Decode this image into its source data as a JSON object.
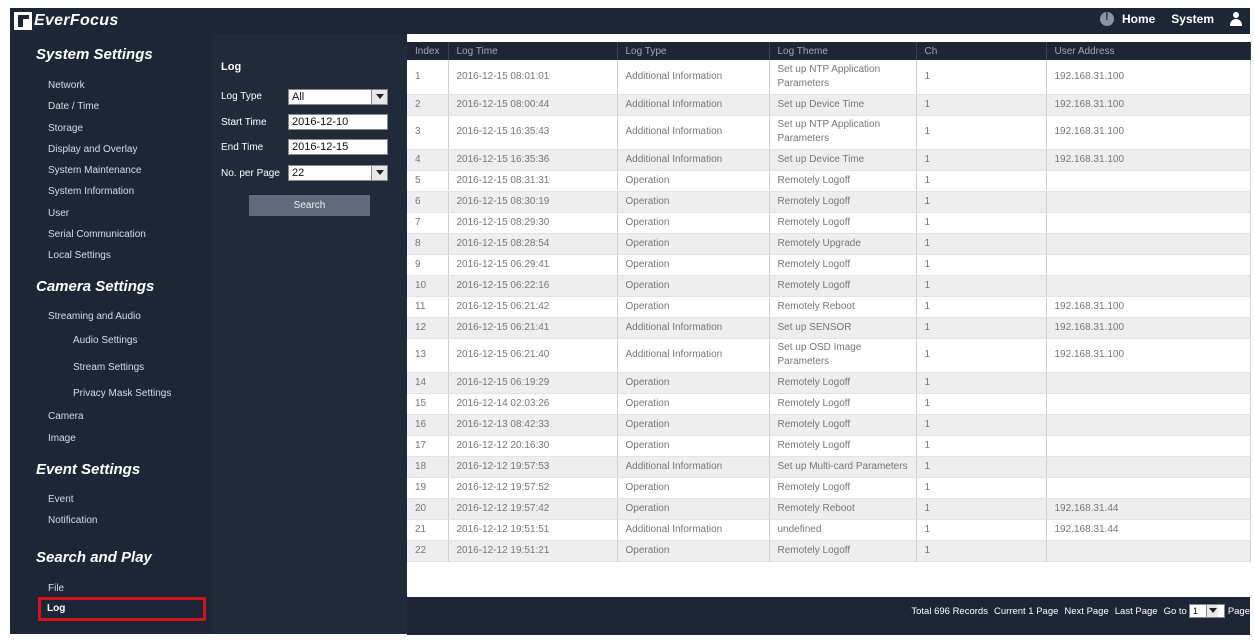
{
  "header": {
    "brand": "EverFocus",
    "home": "Home",
    "system": "System"
  },
  "sidebar": {
    "system_settings": "System Settings",
    "system_items": [
      "Network",
      "Date / Time",
      "Storage",
      "Display and Overlay",
      "System Maintenance",
      "System Information",
      "User",
      "Serial Communication",
      "Local Settings"
    ],
    "camera_settings": "Camera Settings",
    "streaming": "Streaming and Audio",
    "audio": "Audio Settings",
    "stream": "Stream Settings",
    "privacy": "Privacy Mask Settings",
    "camera": "Camera",
    "image": "Image",
    "event_settings": "Event Settings",
    "event": "Event",
    "notification": "Notification",
    "search_play": "Search and Play",
    "file": "File",
    "log": "Log"
  },
  "filter": {
    "title": "Log",
    "log_type_label": "Log Type",
    "log_type_value": "All",
    "start_label": "Start Time",
    "start_value": "2016-12-10",
    "end_label": "End Time",
    "end_value": "2016-12-15",
    "per_page_label": "No. per Page",
    "per_page_value": "22",
    "search_label": "Search"
  },
  "table": {
    "headers": [
      "Index",
      "Log Time",
      "Log Type",
      "Log Theme",
      "Ch",
      "User Address"
    ],
    "rows": [
      [
        "1",
        "2016-12-15 08:01:01",
        "Additional Information",
        "Set up NTP Application Parameters",
        "1",
        "192.168.31.100"
      ],
      [
        "2",
        "2016-12-15 08:00:44",
        "Additional Information",
        "Set up Device Time",
        "1",
        "192.168.31.100"
      ],
      [
        "3",
        "2016-12-15 16:35:43",
        "Additional Information",
        "Set up NTP Application Parameters",
        "1",
        "192.168.31.100"
      ],
      [
        "4",
        "2016-12-15 16:35:36",
        "Additional Information",
        "Set up Device Time",
        "1",
        "192.168.31.100"
      ],
      [
        "5",
        "2016-12-15 08:31:31",
        "Operation",
        "Remotely Logoff",
        "1",
        ""
      ],
      [
        "6",
        "2016-12-15 08:30:19",
        "Operation",
        "Remotely Logoff",
        "1",
        ""
      ],
      [
        "7",
        "2016-12-15 08:29:30",
        "Operation",
        "Remotely Logoff",
        "1",
        ""
      ],
      [
        "8",
        "2016-12-15 08:28:54",
        "Operation",
        "Remotely Upgrade",
        "1",
        ""
      ],
      [
        "9",
        "2016-12-15 06:29:41",
        "Operation",
        "Remotely Logoff",
        "1",
        ""
      ],
      [
        "10",
        "2016-12-15 06:22:16",
        "Operation",
        "Remotely Logoff",
        "1",
        ""
      ],
      [
        "11",
        "2016-12-15 06:21:42",
        "Operation",
        "Remotely Reboot",
        "1",
        "192.168.31.100"
      ],
      [
        "12",
        "2016-12-15 06:21:41",
        "Additional Information",
        "Set up SENSOR",
        "1",
        "192.168.31.100"
      ],
      [
        "13",
        "2016-12-15 06:21:40",
        "Additional Information",
        "Set up OSD Image Parameters",
        "1",
        "192.168.31.100"
      ],
      [
        "14",
        "2016-12-15 06:19:29",
        "Operation",
        "Remotely Logoff",
        "1",
        ""
      ],
      [
        "15",
        "2016-12-14 02:03:26",
        "Operation",
        "Remotely Logoff",
        "1",
        ""
      ],
      [
        "16",
        "2016-12-13 08:42:33",
        "Operation",
        "Remotely Logoff",
        "1",
        ""
      ],
      [
        "17",
        "2016-12-12 20:16:30",
        "Operation",
        "Remotely Logoff",
        "1",
        ""
      ],
      [
        "18",
        "2016-12-12 19:57:53",
        "Additional Information",
        "Set up Multi-card Parameters",
        "1",
        ""
      ],
      [
        "19",
        "2016-12-12 19:57:52",
        "Operation",
        "Remotely Logoff",
        "1",
        ""
      ],
      [
        "20",
        "2016-12-12 19:57:42",
        "Operation",
        "Remotely Reboot",
        "1",
        "192.168.31.44"
      ],
      [
        "21",
        "2016-12-12 19:51:51",
        "Additional Information",
        "undefined",
        "1",
        "192.168.31.44"
      ],
      [
        "22",
        "2016-12-12 19:51:21",
        "Operation",
        "Remotely Logoff",
        "1",
        ""
      ]
    ]
  },
  "footer": {
    "total": "Total 696 Records",
    "current": "Current 1 Page",
    "next": "Next Page",
    "last": "Last Page",
    "goto": "Go to",
    "goto_value": "1",
    "page": "Page"
  }
}
